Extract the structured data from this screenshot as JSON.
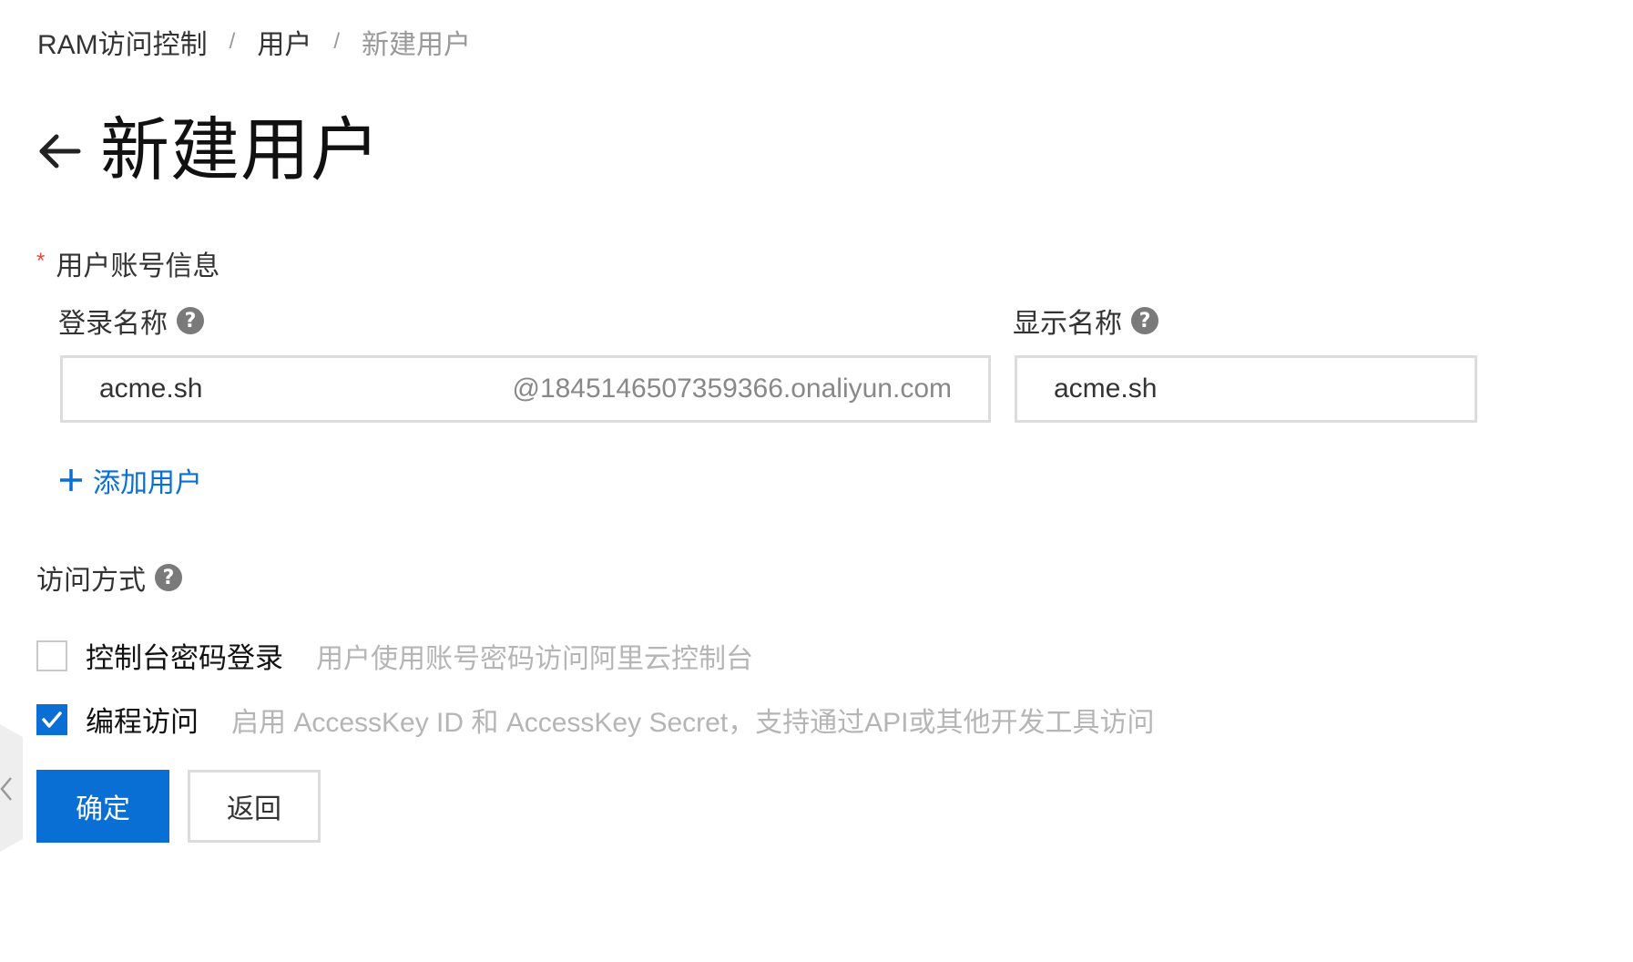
{
  "breadcrumb": {
    "items": [
      "RAM访问控制",
      "用户",
      "新建用户"
    ],
    "separator": "/"
  },
  "header": {
    "title": "新建用户"
  },
  "user_account": {
    "section_label": "用户账号信息",
    "login_name": {
      "label": "登录名称",
      "value": "acme.sh",
      "suffix": "@1845146507359366.onaliyun.com"
    },
    "display_name": {
      "label": "显示名称",
      "value": "acme.sh"
    },
    "add_user_label": "添加用户"
  },
  "access_mode": {
    "label": "访问方式",
    "options": [
      {
        "label": "控制台密码登录",
        "description": "用户使用账号密码访问阿里云控制台",
        "checked": false
      },
      {
        "label": "编程访问",
        "description": "启用 AccessKey ID 和 AccessKey Secret，支持通过API或其他开发工具访问",
        "checked": true
      }
    ]
  },
  "actions": {
    "confirm_label": "确定",
    "back_label": "返回"
  },
  "colors": {
    "primary": "#0a6fd4",
    "required": "#e84a3c",
    "muted_text": "#b5b5b5",
    "border": "#dcdcdc"
  }
}
